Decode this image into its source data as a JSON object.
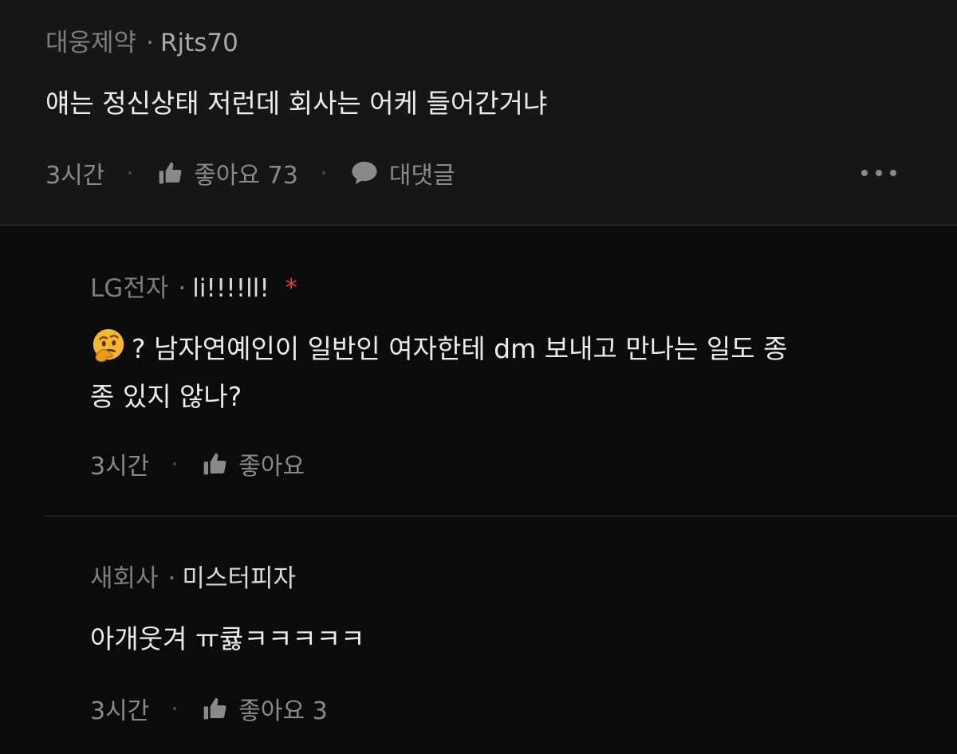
{
  "comments": [
    {
      "company": "대웅제약",
      "nickname": "Rjts70",
      "text": "얘는 정신상태 저런데 회사는 어케 들어간거냐",
      "time": "3시간",
      "like_label": "좋아요 73",
      "reply_label": "대댓글"
    }
  ],
  "replies": [
    {
      "company": "LG전자",
      "nickname": "li!!!!ll!",
      "badge": "*",
      "emoji": "thinking-face",
      "line1": "? 남자연예인이 일반인 여자한테 dm 보내고 만나는 일도 종",
      "line2": "종 있지 않나?",
      "time": "3시간",
      "like_label": "좋아요"
    },
    {
      "company": "새회사",
      "nickname": "미스터피자",
      "text": "아개웃겨 ㅠ큟ㅋㅋㅋㅋㅋ",
      "time": "3시간",
      "like_label": "좋아요 3"
    }
  ],
  "separator": "·",
  "colors": {
    "background": "#0b0b0b",
    "top_comment_background": "#161616",
    "text": "#ececec",
    "meta": "#7d7d7d",
    "badge": "#e0403a"
  },
  "icons": [
    "thumbs-up-icon",
    "speech-bubble-icon",
    "more-icon",
    "thinking-face-emoji"
  ]
}
